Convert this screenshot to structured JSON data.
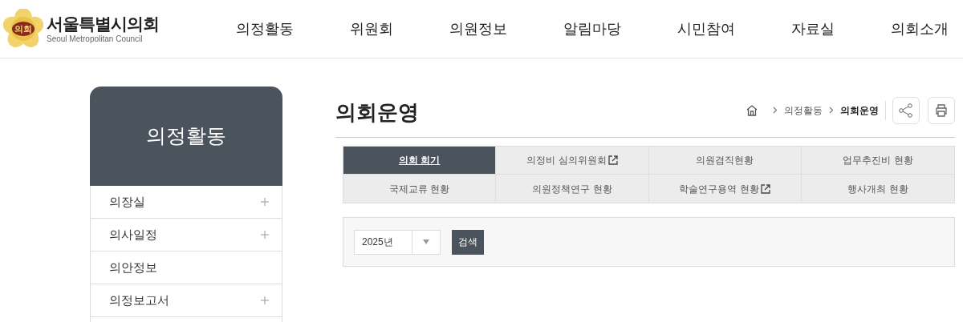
{
  "logo": {
    "emblem_text": "의회",
    "name": "서울특별시의회",
    "subtitle": "Seoul Metropolitan Council"
  },
  "nav": [
    "의정활동",
    "위원회",
    "의원정보",
    "알림마당",
    "시민참여",
    "자료실",
    "의회소개"
  ],
  "sidebar": {
    "title": "의정활동",
    "items": [
      {
        "label": "의장실",
        "expandable": true
      },
      {
        "label": "의사일정",
        "expandable": true
      },
      {
        "label": "의안정보",
        "expandable": false
      },
      {
        "label": "의정보고서",
        "expandable": true
      }
    ]
  },
  "page_title": "의회운영",
  "breadcrumb": [
    "의정활동",
    "의회운영"
  ],
  "tabs": [
    {
      "label": "의회 회기",
      "selected": true,
      "external": false
    },
    {
      "label": "의정비 심의위원회",
      "selected": false,
      "external": true
    },
    {
      "label": "의원겸직현황",
      "selected": false,
      "external": false
    },
    {
      "label": "업무추진비 현황",
      "selected": false,
      "external": false
    },
    {
      "label": "국제교류 현황",
      "selected": false,
      "external": false
    },
    {
      "label": "의원정책연구 현황",
      "selected": false,
      "external": false
    },
    {
      "label": "학술연구용역 현황",
      "selected": false,
      "external": true
    },
    {
      "label": "행사개최 현황",
      "selected": false,
      "external": false
    }
  ],
  "filter": {
    "year": "2025년",
    "button": "검색"
  }
}
